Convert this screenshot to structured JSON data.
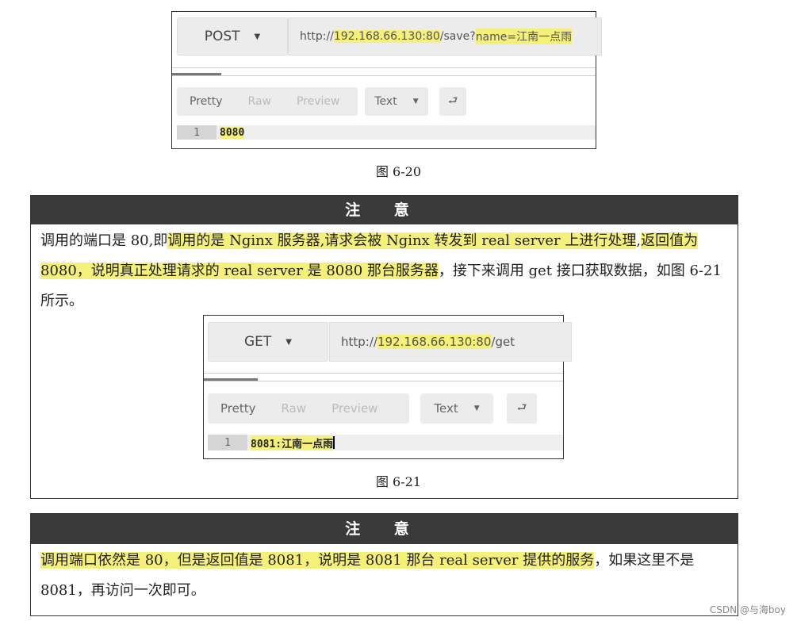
{
  "figure_6_20": {
    "method": "POST",
    "url_parts": [
      {
        "text": "http://",
        "hl": false
      },
      {
        "text": "192.168.66.130:80",
        "hl": true
      },
      {
        "text": "/save?",
        "hl": false
      },
      {
        "text": "name=江南一点雨",
        "hl": true
      }
    ],
    "tabs": [
      "Pretty",
      "Raw",
      "Preview"
    ],
    "format": "Text",
    "line_number": "1",
    "response": "8080",
    "caption": "图 6-20"
  },
  "note1": {
    "title": "注 意",
    "segments": [
      {
        "text": "调用的端口是 80,即",
        "hl": false
      },
      {
        "text": "调用的是 Nginx 服务器,请求会被 Nginx 转发到 real server 上进行处理",
        "hl": true
      },
      {
        "text": ",",
        "hl": false
      },
      {
        "text": "返回值为 8080，说明真正处理请求的 real  server 是 8080 那台服务器",
        "hl": true
      },
      {
        "text": "，接下来调用 get 接口获取数据，如图 6-21 所示。",
        "hl": false
      }
    ]
  },
  "figure_6_21": {
    "method": "GET",
    "url_parts": [
      {
        "text": "http://",
        "hl": false
      },
      {
        "text": "192.168.66.130:80",
        "hl": true
      },
      {
        "text": "/get",
        "hl": false
      }
    ],
    "tabs": [
      "Pretty",
      "Raw",
      "Preview"
    ],
    "format": "Text",
    "line_number": "1",
    "response": "8081:江南一点雨",
    "caption": "图 6-21"
  },
  "note2": {
    "title": "注 意",
    "segments": [
      {
        "text": "调用端口依然是 80，但是返回值是 8081，说明是 8081 那台 real server 提供的服务",
        "hl": true
      },
      {
        "text": "，如果这里不是 8081，再访问一次即可。",
        "hl": false
      }
    ]
  },
  "watermark": "CSDN @与海boy",
  "colors": {
    "highlight": "#f5f07a",
    "note_header": "#3a3a3a"
  }
}
